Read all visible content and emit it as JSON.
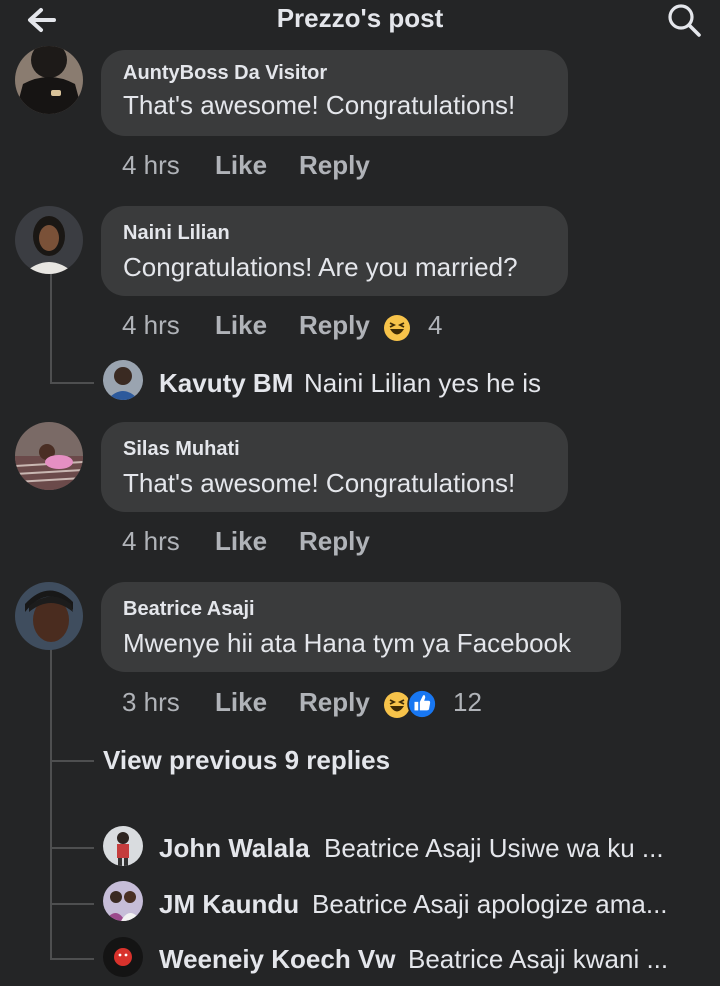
{
  "header": {
    "title": "Prezzo's post",
    "back_icon": "back-arrow-icon",
    "search_icon": "search-icon"
  },
  "comments": [
    {
      "author": "AuntyBoss Da Visitor",
      "text": "That's awesome! Congratulations!",
      "time": "4 hrs",
      "like_label": "Like",
      "reply_label": "Reply"
    },
    {
      "author": "Naini Lilian",
      "text": "Congratulations! Are you married?",
      "time": "4 hrs",
      "like_label": "Like",
      "reply_label": "Reply",
      "reactions": [
        "haha-icon"
      ],
      "reaction_count": "4",
      "replies": [
        {
          "author": "Kavuty BM",
          "text": "Naini Lilian yes he is"
        }
      ]
    },
    {
      "author": "Silas Muhati",
      "text": "That's awesome! Congratulations!",
      "time": "4 hrs",
      "like_label": "Like",
      "reply_label": "Reply"
    },
    {
      "author": "Beatrice Asaji",
      "text": "Mwenye hii ata Hana tym ya Facebook",
      "time": "3 hrs",
      "like_label": "Like",
      "reply_label": "Reply",
      "reactions": [
        "haha-icon",
        "thumbs-up-icon"
      ],
      "reaction_count": "12",
      "view_previous": "View previous 9 replies",
      "replies": [
        {
          "author": "John Walala",
          "text": "Beatrice Asaji Usiwe wa ku ..."
        },
        {
          "author": "JM Kaundu",
          "text": "Beatrice Asaji apologize ama..."
        },
        {
          "author": "Weeneiy Koech Vw",
          "text": "Beatrice Asaji kwani ..."
        }
      ]
    }
  ],
  "colors": {
    "background": "#242526",
    "bubble": "#3a3b3c",
    "primary_text": "#e4e6eb",
    "secondary_text": "#b0b3b8",
    "haha_yellow": "#f7c34a",
    "like_blue": "#1877f2"
  }
}
